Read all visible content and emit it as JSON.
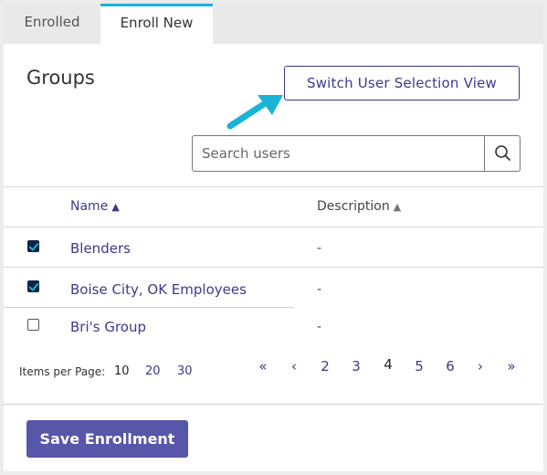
{
  "tabs": [
    {
      "label": "Enrolled",
      "active": false
    },
    {
      "label": "Enroll New",
      "active": true
    }
  ],
  "panel": {
    "title": "Groups",
    "switch_button": "Switch User Selection View"
  },
  "search": {
    "placeholder": "Search users",
    "icon": "search-icon"
  },
  "table": {
    "columns": [
      {
        "label": "Name",
        "sort": "ascending"
      },
      {
        "label": "Description",
        "sort": "ascending"
      }
    ],
    "rows": [
      {
        "name": "Blenders",
        "description": "-",
        "checked": true
      },
      {
        "name": "Boise City, OK Employees",
        "description": "-",
        "checked": true
      },
      {
        "name": "Bri's Group",
        "description": "-",
        "checked": false
      }
    ]
  },
  "pagination": {
    "items_per_page_label": "Items per Page:",
    "items_per_page_options": [
      "10",
      "20",
      "30"
    ],
    "items_per_page_selected": "10",
    "first": "«",
    "prev": "‹",
    "pages": [
      "2",
      "3",
      "4",
      "5",
      "6"
    ],
    "current_page": "4",
    "next": "›",
    "last": "»"
  },
  "footer": {
    "save_button": "Save Enrollment"
  },
  "colors": {
    "accent": "#3d3a8a",
    "tab_highlight": "#19b3d6",
    "save_button_bg": "#5856a8",
    "arrow": "#19b3d6"
  }
}
